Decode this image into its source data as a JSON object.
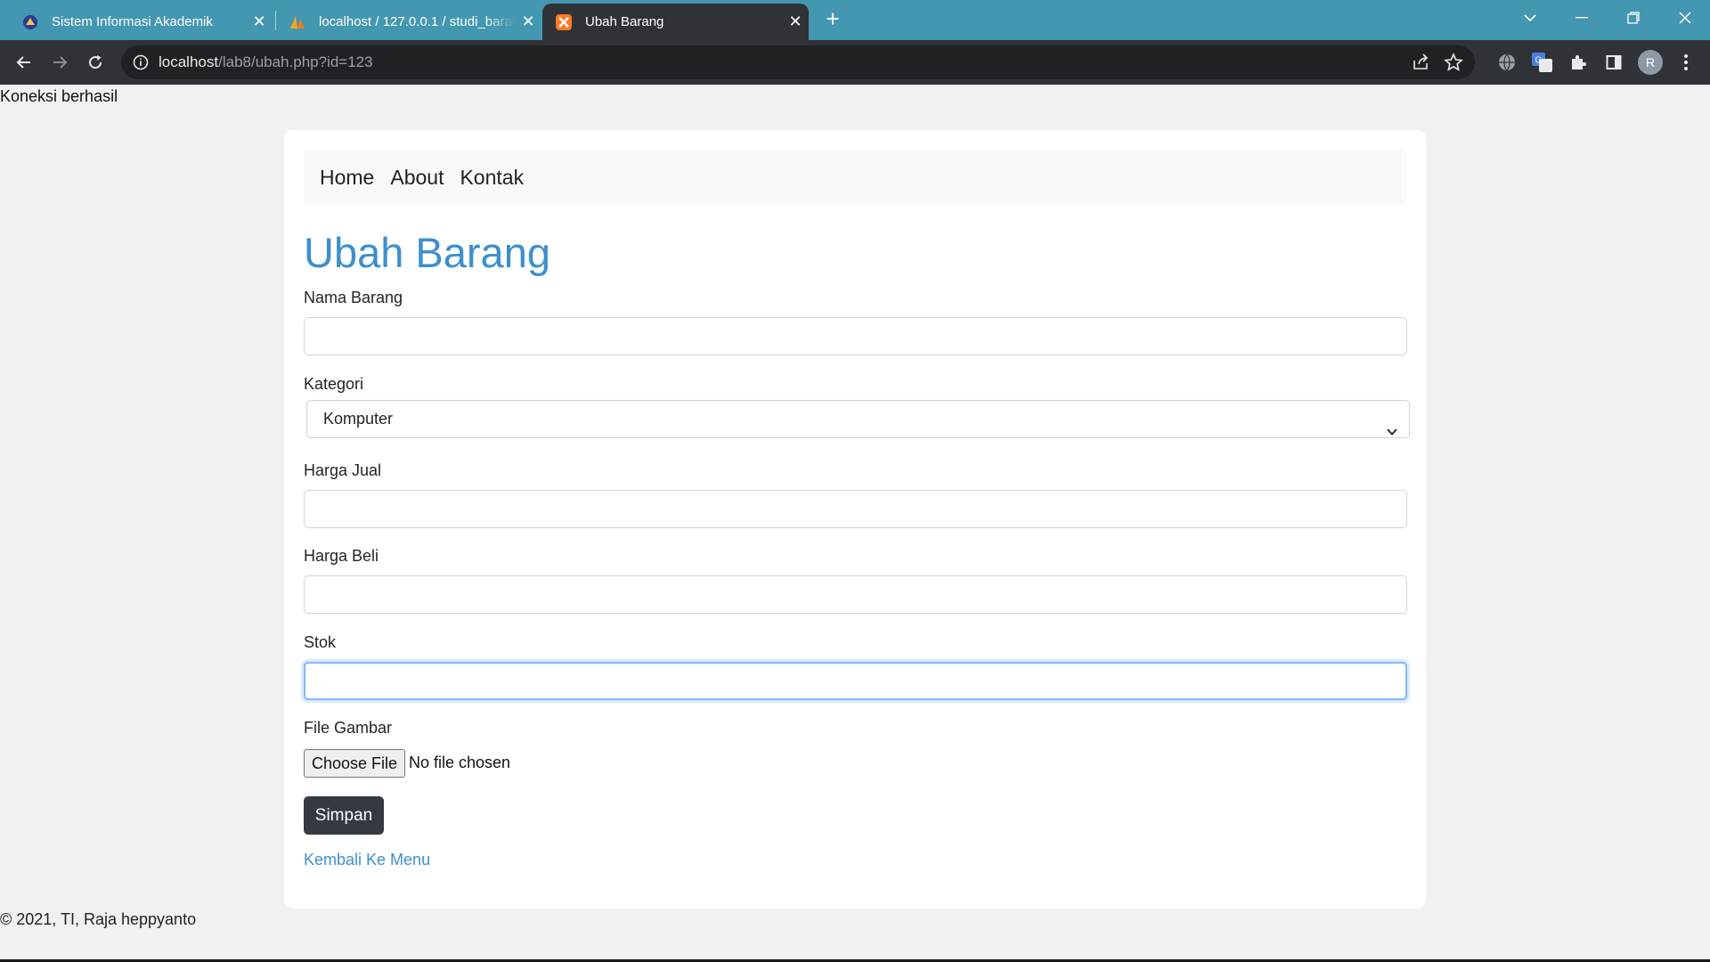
{
  "browser": {
    "tabs": [
      {
        "title": "Sistem Informasi Akademik",
        "favicon": "university-logo-icon"
      },
      {
        "title": "localhost / 127.0.0.1 / studi_barang",
        "favicon": "phpmyadmin-sail-icon"
      },
      {
        "title": "Ubah Barang",
        "favicon": "xampp-icon",
        "active": true
      }
    ],
    "url_host": "localhost",
    "url_path": "/lab8/ubah.php?id=123",
    "colors": {
      "tabbar": "#4497b0",
      "toolbar": "#2f3236"
    },
    "profile_initial": "R"
  },
  "status": {
    "connection": "Koneksi berhasil"
  },
  "nav": {
    "items": [
      "Home",
      "About",
      "Kontak"
    ]
  },
  "page": {
    "title": "Ubah Barang",
    "accent": "#3d8fce"
  },
  "form": {
    "nama_label": "Nama Barang",
    "nama_value": "",
    "kategori_label": "Kategori",
    "kategori_value": "Komputer",
    "harga_jual_label": "Harga Jual",
    "harga_jual_value": "",
    "harga_beli_label": "Harga Beli",
    "harga_beli_value": "",
    "stok_label": "Stok",
    "stok_value": "",
    "file_label": "File Gambar",
    "file_button": "Choose File",
    "file_status": "No file chosen",
    "submit_label": "Simpan",
    "back_link": "Kembali Ke Menu"
  },
  "footer": {
    "text": "© 2021, TI, Raja heppyanto"
  }
}
